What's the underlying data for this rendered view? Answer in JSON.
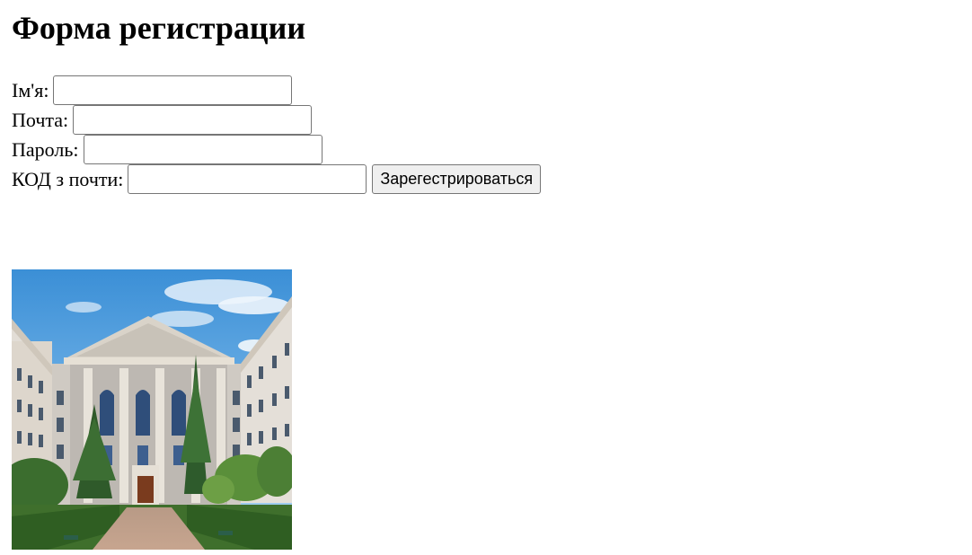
{
  "page": {
    "title": "Форма регистрации"
  },
  "form": {
    "name_label": "Ім'я:",
    "email_label": "Почта:",
    "password_label": "Пароль:",
    "code_label": "КОД з почти:",
    "name_value": "",
    "email_value": "",
    "password_value": "",
    "code_value": "",
    "submit_label": "Зарегестрироваться"
  },
  "image": {
    "description_icon": "university-building-photo"
  }
}
